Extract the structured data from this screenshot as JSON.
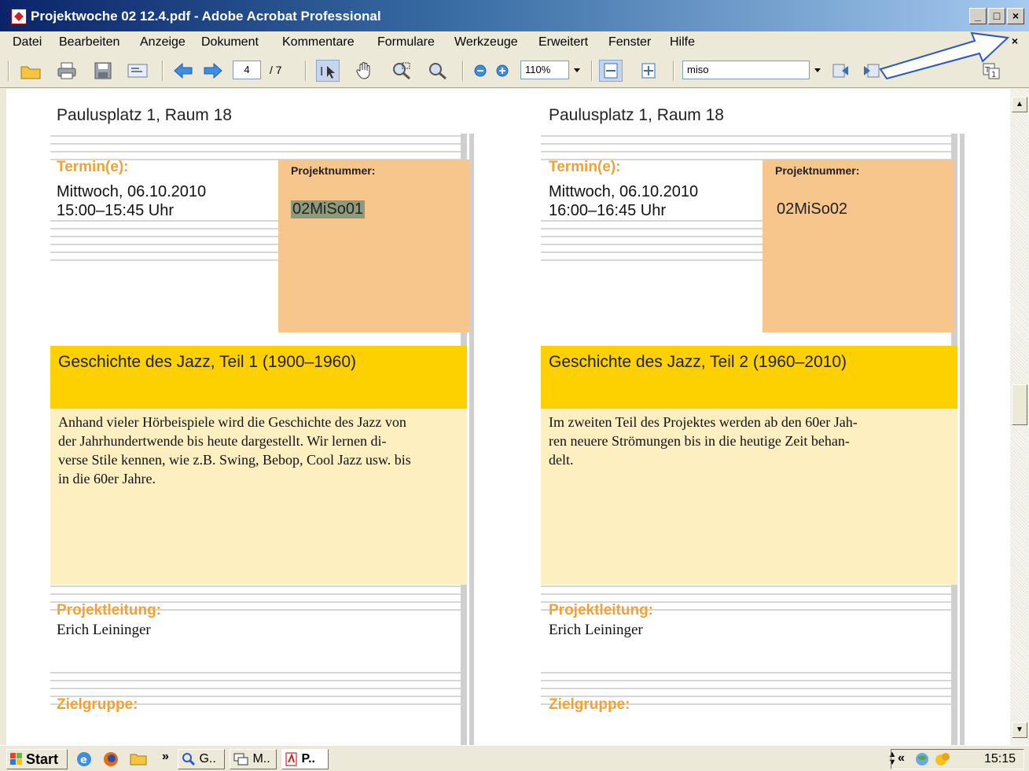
{
  "window": {
    "title": "Projektwoche 02 12.4.pdf - Adobe Acrobat Professional",
    "min_label": "_",
    "max_label": "□",
    "close_label": "×"
  },
  "menu": {
    "items": [
      "Datei",
      "Bearbeiten",
      "Anzeige",
      "Dokument",
      "Kommentare",
      "Formulare",
      "Werkzeuge",
      "Erweitert",
      "Fenster",
      "Hilfe"
    ],
    "close_doc": "×"
  },
  "toolbar": {
    "page_current": "4",
    "page_total": "/ 7",
    "zoom": "110%",
    "search": "miso",
    "icons": [
      "open-folder-icon",
      "print-icon",
      "save-icon",
      "email-icon",
      "previous-page-icon",
      "next-page-icon",
      "select-text-icon",
      "hand-tool-icon",
      "zoom-marquee-icon",
      "zoom-loupe-icon",
      "zoom-out-icon",
      "zoom-in-icon",
      "fit-width-icon",
      "fit-page-icon",
      "search-previous-icon",
      "search-next-icon",
      "text-field-icon"
    ]
  },
  "pages": [
    {
      "address": "Paulusplatz 1, Raum 18",
      "termin_label": "Termin(e):",
      "date": "Mittwoch, 06.10.2010",
      "time": "15:00–15:45 Uhr",
      "proj_label": "Projektnummer:",
      "proj_num": "02MiSo01",
      "title": "Geschichte des Jazz, Teil 1 (1900–1960)",
      "desc_lines": [
        "Anhand vieler Hörbeispiele wird die Geschichte des Jazz von",
        "der Jahrhundertwende bis heute dargestellt. Wir lernen di-",
        "verse Stile kennen, wie z.B. Swing, Bebop, Cool Jazz usw. bis",
        "in die 60er Jahre."
      ],
      "lead_label": "Projektleitung:",
      "lead_name": "Erich Leininger",
      "target_label": "Zielgruppe:"
    },
    {
      "address": "Paulusplatz 1, Raum 18",
      "termin_label": "Termin(e):",
      "date": "Mittwoch, 06.10.2010",
      "time": "16:00–16:45 Uhr",
      "proj_label": "Projektnummer:",
      "proj_num": "02MiSo02",
      "title": "Geschichte des Jazz, Teil 2 (1960–2010)",
      "desc_lines": [
        "Im zweiten Teil des Projektes werden ab den 60er Jah-",
        "ren neuere Strömungen bis in die heutige Zeit behan-",
        "delt."
      ],
      "lead_label": "Projektleitung:",
      "lead_name": "Erich Leininger",
      "target_label": "Zielgruppe:"
    }
  ],
  "taskbar": {
    "start": "Start",
    "overflow": "»",
    "tasks": [
      "G..",
      "M..",
      "P.."
    ],
    "tray_chevron": "«",
    "clock": "15:15"
  },
  "colors": {
    "label_orange": "#f2a133",
    "proj_box": "#f6c68c",
    "title_band": "#fdd000",
    "desc_box": "#fdefbf",
    "selection": "#8d9a7d"
  }
}
